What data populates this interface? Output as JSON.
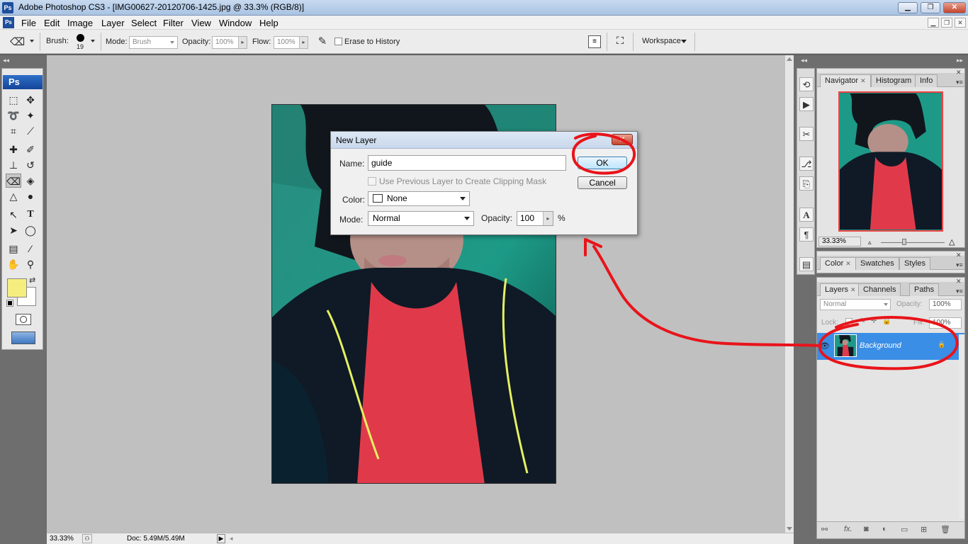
{
  "window": {
    "title": "Adobe Photoshop CS3 - [IMG00627-20120706-1425.jpg @ 33.3% (RGB/8)]",
    "app_icon": "Ps"
  },
  "menu": [
    "File",
    "Edit",
    "Image",
    "Layer",
    "Select",
    "Filter",
    "View",
    "Window",
    "Help"
  ],
  "options": {
    "brush_label": "Brush:",
    "brush_size": "19",
    "mode_label": "Mode:",
    "mode_value": "Brush",
    "opacity_label": "Opacity:",
    "opacity_value": "100%",
    "flow_label": "Flow:",
    "flow_value": "100%",
    "erase_history_label": "Erase to History",
    "workspace_label": "Workspace"
  },
  "toolbox": {
    "badge": "Ps",
    "foreground_color": "#f5ee7f",
    "background_color": "#ffffff"
  },
  "status": {
    "zoom": "33.33%",
    "doc": "Doc: 5.49M/5.49M"
  },
  "dialog": {
    "title": "New Layer",
    "name_label": "Name:",
    "name_value": "guide",
    "clipping_label": "Use Previous Layer to Create Clipping Mask",
    "color_label": "Color:",
    "color_value": "None",
    "mode_label": "Mode:",
    "mode_value": "Normal",
    "opacity_label": "Opacity:",
    "opacity_value": "100",
    "percent": "%",
    "ok_label": "OK",
    "cancel_label": "Cancel"
  },
  "navigator": {
    "tabs": [
      "Navigator",
      "Histogram",
      "Info"
    ],
    "zoom": "33.33%"
  },
  "color_panel": {
    "tabs": [
      "Color",
      "Swatches",
      "Styles"
    ]
  },
  "layers_panel": {
    "tabs": [
      "Layers",
      "Channels",
      "Paths"
    ],
    "blend_mode": "Normal",
    "opacity_label": "Opacity:",
    "opacity_value": "100%",
    "lock_label": "Lock:",
    "fill_label": "Fill:",
    "fill_value": "100%",
    "layer_name": "Background"
  },
  "annotation_color": "#e8141a"
}
